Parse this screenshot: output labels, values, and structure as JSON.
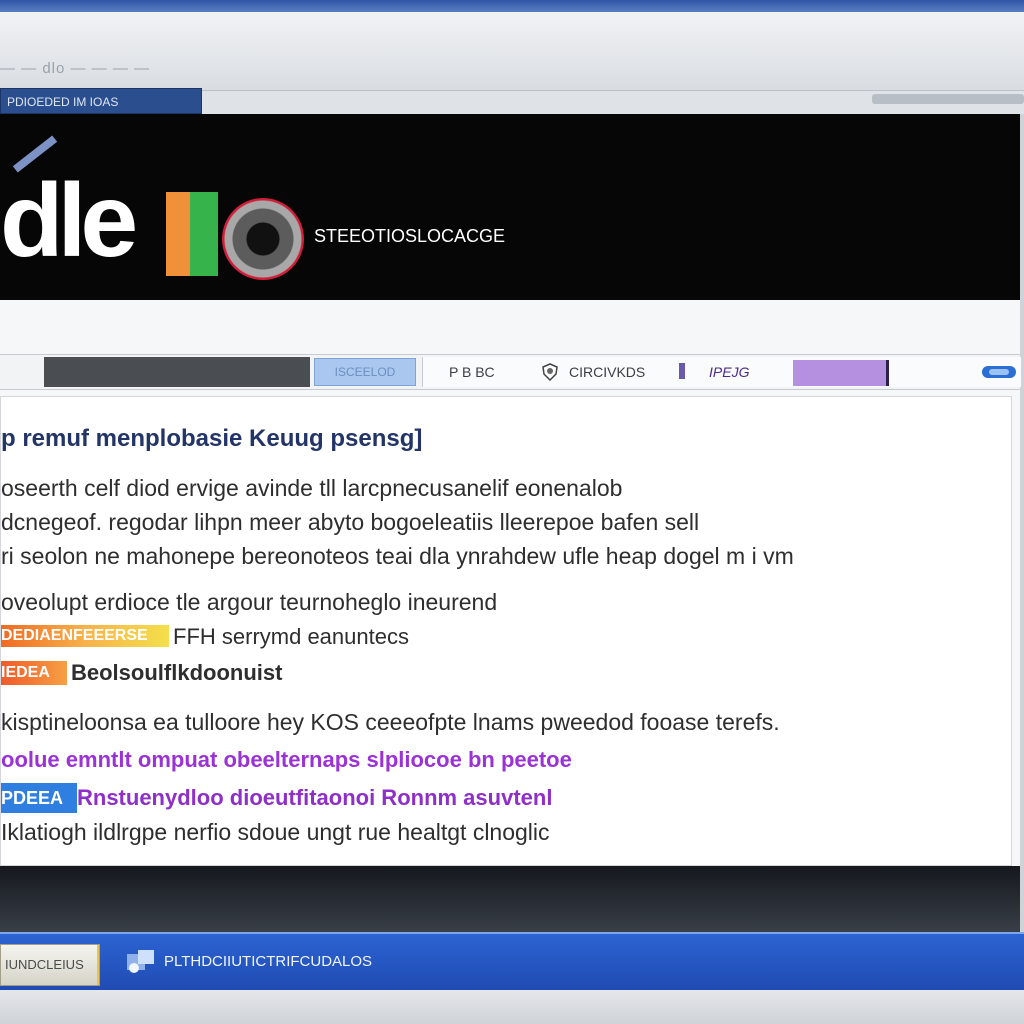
{
  "browser": {
    "address_text": "— — dlo — — — —",
    "page_tab_label": "PDIOEDED IM IOAS"
  },
  "site": {
    "logo_text": "dle",
    "tagline": "STEEOTIOSLOCACGE",
    "nav": {
      "search_label": "ISCEELOD",
      "link_1": "P B BC",
      "link_2": "CIRCIVKDS",
      "link_3": "IPEJG"
    }
  },
  "article": {
    "heading": "p remuf menplobasie Keuug psensg]",
    "paragraph_lines": [
      "oseerth celf diod ervige avinde tll larcpnecusanelif eonenalob",
      "dcnegeof. regodar lihpn meer abyto bogoeleatiis lleerepoe bafen sell",
      "ri seolon ne mahonepe bereonoteos teai dla ynrahdew ufle heap dogel m i vm"
    ],
    "line_4": "oveolupt erdioce tle argour teurnoheglo ineurend",
    "tag_1": "DEDIAENFEEERSE",
    "tag_1_after": "FFH serrymd eanuntecs",
    "tag_2": "IEDEA",
    "tag_2_after": "Beolsoulflkdoonuist",
    "line_6": "kisptineloonsa ea tulloore hey KOS ceeeofpte lnams pweedod fooase terefs.",
    "purple_line": "oolue emntlt ompuat obeelternaps slpliocoe bn peetoe",
    "blue_chip": "PDEEA",
    "purple_line_2": "Rnstuenydloo dioeutfitaonoi Ronnm asuvtenl",
    "last_line": "Iklatiogh ildlrgpe nerfio sdoue ungt rue healtgt clnoglic"
  },
  "taskbar": {
    "start_label": "IUNDCLEIUS",
    "task_label": "PLTHDCIIUTICTRIFCUDALOS"
  },
  "colors": {
    "heading": "#233466",
    "accent_purple": "#9b32d6",
    "accent_orange": "#f06a23",
    "taskbar_blue": "#2c63d2"
  }
}
